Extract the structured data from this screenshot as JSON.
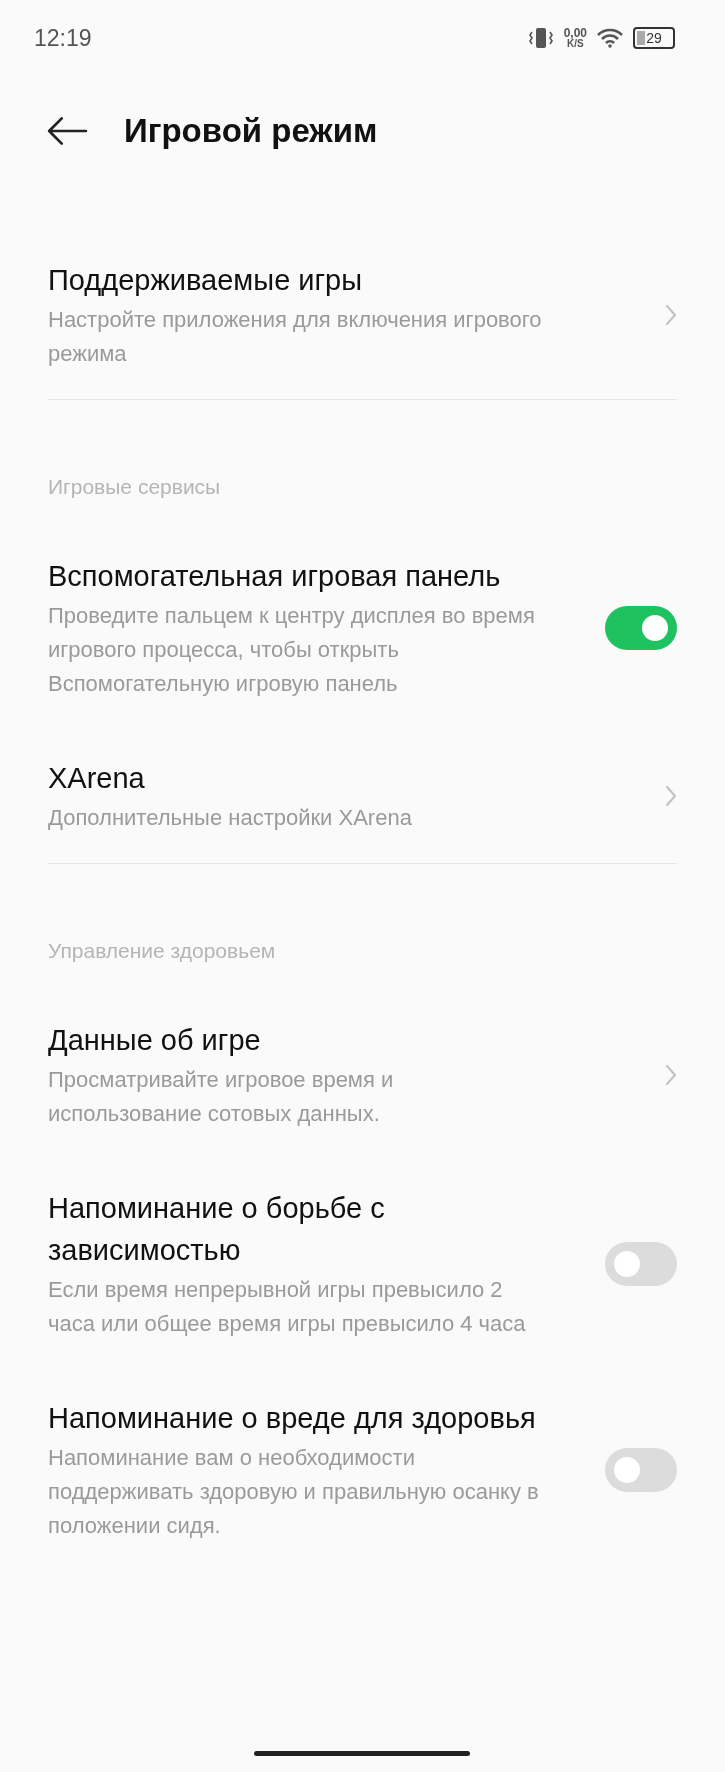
{
  "status_bar": {
    "time": "12:19",
    "net_speed": "0,00",
    "net_unit": "K/S",
    "battery": "29"
  },
  "header": {
    "title": "Игровой режим"
  },
  "sections": [
    {
      "items": [
        {
          "kind": "link",
          "title": "Поддерживаемые игры",
          "subtitle": "Настройте приложения для включения игрового режима"
        }
      ]
    },
    {
      "header": "Игровые сервисы",
      "items": [
        {
          "kind": "switch",
          "title": "Вспомогательная игровая панель",
          "subtitle": "Проведите пальцем к центру дисплея во время игрового процесса, чтобы открыть Вспомогательную игровую панель",
          "on": true
        },
        {
          "kind": "link",
          "title": "XArena",
          "subtitle": "Дополнительные настройки XArena"
        }
      ]
    },
    {
      "header": "Управление здоровьем",
      "items": [
        {
          "kind": "link",
          "title": "Данные об игре",
          "subtitle": "Просматривайте игровое время и использование сотовых данных."
        },
        {
          "kind": "switch",
          "title": "Напоминание о борьбе с зависимостью",
          "subtitle": "Если время непрерывной игры превысило 2 часа или общее время игры превысило 4 часа",
          "on": false
        },
        {
          "kind": "switch",
          "title": "Напоминание о вреде для здоровья",
          "subtitle": "Напоминание вам о необходимости поддерживать здоровую и правильную осанку в положении сидя.",
          "on": false
        }
      ]
    }
  ]
}
